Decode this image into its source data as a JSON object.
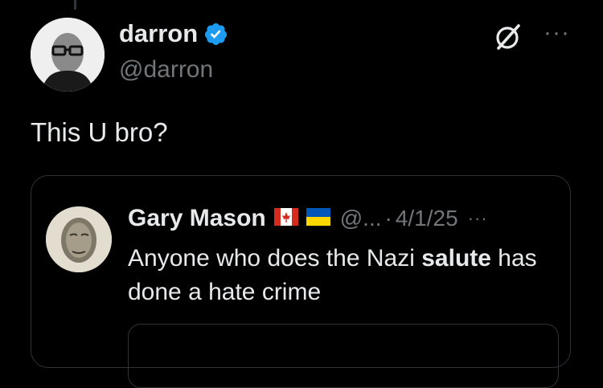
{
  "tweet": {
    "author_name": "darron",
    "author_handle": "@darron",
    "text": "This U bro?"
  },
  "quote": {
    "author_name": "Gary Mason",
    "flags": [
      "canada-flag",
      "ukraine-flag"
    ],
    "handle_truncated": "@...",
    "separator": "·",
    "date": "4/1/25",
    "more": "···",
    "text_before": "Anyone who does the Nazi ",
    "text_bold": "salute",
    "text_after": " has done a hate crime"
  },
  "actions": {
    "more": "···"
  },
  "colors": {
    "verified": "#1d9bf0",
    "secondary_text": "#71767b",
    "border": "#2f3336"
  }
}
